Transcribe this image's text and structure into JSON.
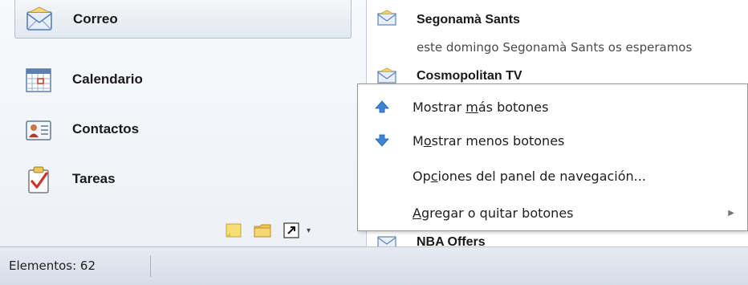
{
  "nav": {
    "items": [
      {
        "label": "Correo",
        "icon": "mail-envelope-icon",
        "selected": true
      },
      {
        "label": "Calendario",
        "icon": "calendar-icon"
      },
      {
        "label": "Contactos",
        "icon": "contacts-card-icon"
      },
      {
        "label": "Tareas",
        "icon": "tasks-clipboard-icon"
      }
    ],
    "mini_buttons": [
      "notes-icon",
      "folder-icon",
      "shortcut-icon",
      "configure-buttons-chevron-icon"
    ]
  },
  "mail": {
    "items": [
      {
        "sender": "Segonamà Sants",
        "preview": "este domingo Segonamà Sants os esperamos"
      },
      {
        "sender": "Cosmopolitan TV"
      },
      {
        "sender": "NBA Offers"
      }
    ]
  },
  "menu": {
    "items": [
      {
        "pre": "Mostrar ",
        "key": "m",
        "post": "ás botones",
        "icon": "arrow-up-icon"
      },
      {
        "pre": "M",
        "key": "o",
        "post": "strar menos botones",
        "icon": "arrow-down-icon"
      },
      {
        "pre": "Op",
        "key": "c",
        "post": "iones del panel de navegación..."
      },
      {
        "pre": "",
        "key": "A",
        "post": "gregar o quitar botones",
        "submenu": true
      }
    ]
  },
  "status": {
    "count_text": "Elementos: 62"
  },
  "colors": {
    "accent_blue": "#3b86d6",
    "nav_bg": "#eef2f7",
    "status_bg": "#dde3eb"
  }
}
